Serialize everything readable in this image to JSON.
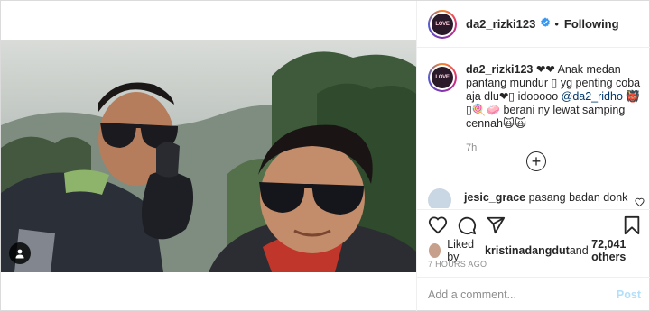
{
  "post": {
    "username": "da2_rizki123",
    "follow_status": "Following",
    "separator": "•",
    "avatar_text": "LOVE",
    "photo_alt": "",
    "caption": {
      "username": "da2_rizki123",
      "text_before": " ❤❤ Anak medan pantang mundur ▯ yg penting coba aja dlu❤▯ idooooo ",
      "mention": "@da2_ridho",
      "text_after": " 👹▯🍭🧼 berani ny lewat samping cennah🙀🙀",
      "age": "7h"
    },
    "more_comments_symbol": "+",
    "comment": {
      "username": "jesic_grace",
      "text": "pasang badan donk"
    },
    "likes": {
      "prefix": "Liked by ",
      "liked_by": "kristinadangdut",
      "middle": " and ",
      "others": "72,041 others"
    },
    "timestamp": "7 HOURS AGO",
    "add_comment": {
      "placeholder": "Add a comment...",
      "post_label": "Post"
    }
  },
  "icons": [
    "verified-badge-icon",
    "user-tag-icon",
    "heart-icon",
    "comment-icon",
    "share-icon",
    "bookmark-icon",
    "plus-circle-icon",
    "comment-like-icon"
  ],
  "colors": {
    "border": "#dbdbdb",
    "text": "#262626",
    "muted": "#8e8e8e",
    "mention": "#00376b",
    "verified": "#3897f0",
    "post_disabled": "#b2dffc"
  }
}
